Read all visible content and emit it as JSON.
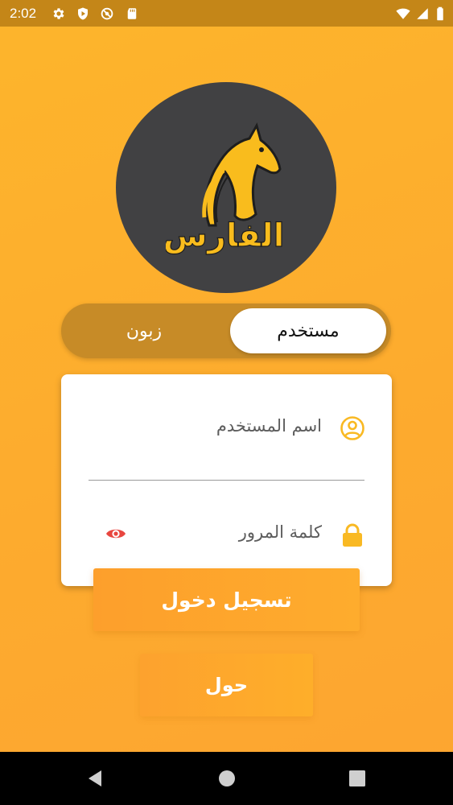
{
  "status_bar": {
    "time": "2:02",
    "icons": [
      "gear-icon",
      "play-protect-icon",
      "no-sync-icon",
      "sd-card-icon",
      "wifi-icon",
      "signal-icon",
      "battery-icon"
    ]
  },
  "logo": {
    "text": "الفارس",
    "icon": "horse-head-icon"
  },
  "account_toggle": {
    "active_label": "مستخدم",
    "inactive_label": "زبون"
  },
  "form": {
    "username_placeholder": "اسم المستخدم",
    "password_placeholder": "كلمة المرور",
    "user_icon": "user-circle-icon",
    "lock_icon": "lock-icon",
    "visibility_icon": "eye-icon"
  },
  "buttons": {
    "login_label": "تسجيل دخول",
    "about_label": "حول"
  },
  "colors": {
    "background": "#fdb02e",
    "accent": "#f9b923",
    "logo_circle": "#414143",
    "toggle_track": "#c78b27",
    "eye_icon": "#e8463f"
  }
}
